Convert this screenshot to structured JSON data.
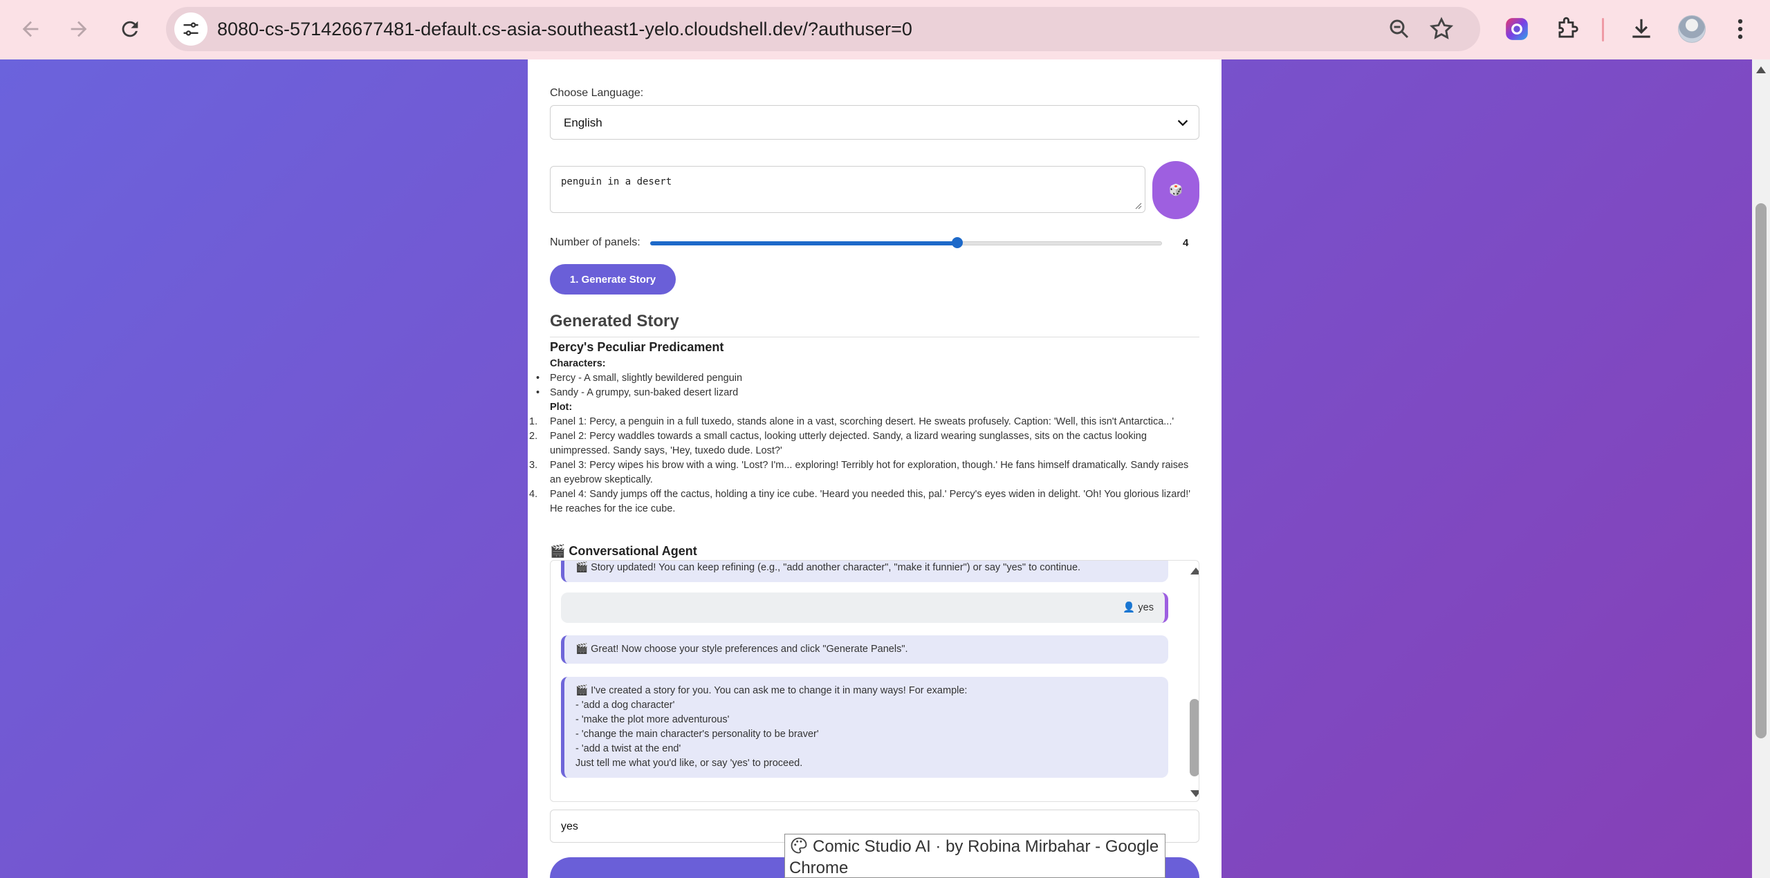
{
  "browser": {
    "url": "8080-cs-571426677481-default.cs-asia-southeast1-yelo.cloudshell.dev/?authuser=0",
    "tooltip": "Comic Studio AI · by Robina Mirbahar - Google Chrome"
  },
  "form": {
    "language_label": "Choose Language:",
    "language_value": "English",
    "prompt_value": "penguin in a desert",
    "dice_label": "🎲",
    "panels_label": "Number of panels:",
    "panels_value": "4",
    "panels_min": 1,
    "panels_max": 6,
    "generate_story_label": "1. Generate Story"
  },
  "story": {
    "heading": "Generated Story",
    "title": "Percy's Peculiar Predicament",
    "characters_label": "Characters:",
    "characters": [
      "Percy - A small, slightly bewildered penguin",
      "Sandy - A grumpy, sun-baked desert lizard"
    ],
    "plot_label": "Plot:",
    "plot": [
      "Panel 1: Percy, a penguin in a full tuxedo, stands alone in a vast, scorching desert. He sweats profusely. Caption: 'Well, this isn't Antarctica...'",
      "Panel 2: Percy waddles towards a small cactus, looking utterly dejected. Sandy, a lizard wearing sunglasses, sits on the cactus looking unimpressed. Sandy says, 'Hey, tuxedo dude. Lost?'",
      "Panel 3: Percy wipes his brow with a wing. 'Lost? I'm... exploring! Terribly hot for exploration, though.' He fans himself dramatically. Sandy raises an eyebrow skeptically.",
      "Panel 4: Sandy jumps off the cactus, holding a tiny ice cube. 'Heard you needed this, pal.' Percy's eyes widen in delight. 'Oh! You glorious lizard!' He reaches for the ice cube."
    ]
  },
  "agent": {
    "title": "🎬 Conversational Agent",
    "messages": {
      "m1": "🎬 Story updated! You can keep refining (e.g., \"add another character\", \"make it funnier\") or say \"yes\" to continue.",
      "m2": "👤 yes",
      "m3": "🎬 Great! Now choose your style preferences and click \"Generate Panels\".",
      "m4_intro": "🎬 I've created a story for you. You can ask me to change it in many ways! For example:",
      "m4_lines": [
        "- 'add a dog character'",
        "- 'make the plot more adventurous'",
        "- 'change the main character's personality to be braver'",
        "- 'add a twist at the end'",
        "Just tell me what you'd like, or say 'yes' to proceed."
      ]
    },
    "input_value": "yes"
  },
  "colors": {
    "accent": "#6a5fd8",
    "dice": "#9e5fe0",
    "slider": "#1d69c9",
    "chrome_bar": "#fbe1e6"
  }
}
